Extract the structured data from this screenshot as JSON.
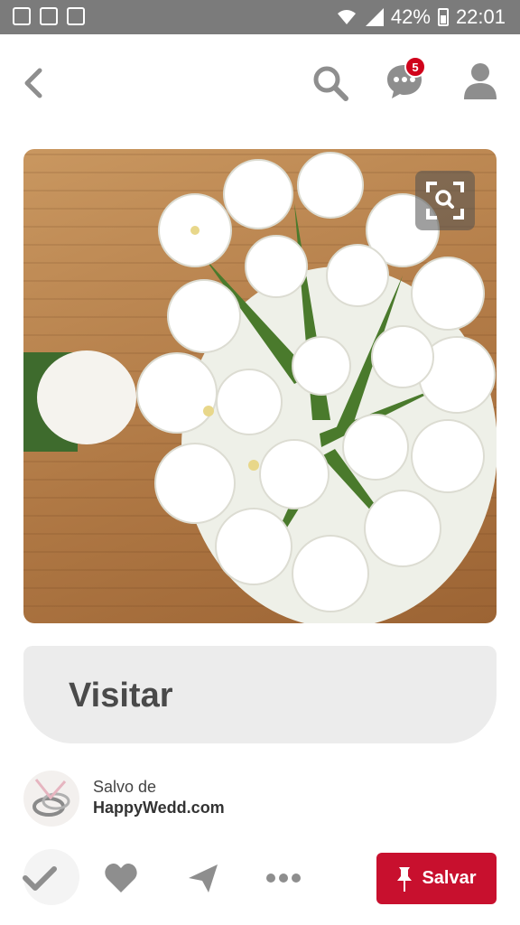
{
  "status_bar": {
    "battery": "42%",
    "time": "22:01",
    "left_icons": [
      "gallery-icon",
      "cleaner-icon",
      "briefcase-icon"
    ]
  },
  "header": {
    "icons": [
      "back-arrow-icon",
      "search-icon",
      "messages-icon",
      "profile-icon"
    ],
    "messages_badge": "5"
  },
  "pin": {
    "image_subject": "white-flower-bouquet",
    "visual_search_icon": "visual-search-icon"
  },
  "visit_button": {
    "label": "Visitar"
  },
  "saved": {
    "prefix": "Salvo de",
    "site": "HappyWedd.com"
  },
  "actions": {
    "icons": [
      "check-icon",
      "heart-icon",
      "send-icon",
      "more-icon"
    ],
    "save_label": "Salvar"
  },
  "colors": {
    "status_bar": "#7b7b7b",
    "accent_red": "#c8102e",
    "badge_red": "#d0021b",
    "icon_gray": "#8e8e8e",
    "visit_bg": "#ececec"
  }
}
